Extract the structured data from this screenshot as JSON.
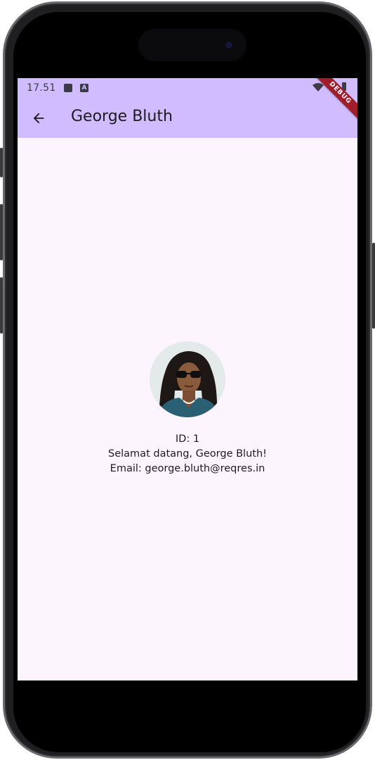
{
  "status_bar": {
    "time": "17.51",
    "icons": [
      "image-icon",
      "a-icon",
      "wifi-icon",
      "battery-icon"
    ]
  },
  "app_bar": {
    "title": "George Bluth",
    "back_icon": "arrow-left-icon"
  },
  "debug_banner": {
    "label": "DEBUG"
  },
  "user": {
    "id_text": "ID: 1",
    "greeting": "Selamat datang, George Bluth!",
    "email_text": "Email: george.bluth@reqres.in"
  },
  "colors": {
    "app_bar": "#d0bcfe",
    "background": "#fcf5fe",
    "debug_banner": "#a01d2c"
  }
}
